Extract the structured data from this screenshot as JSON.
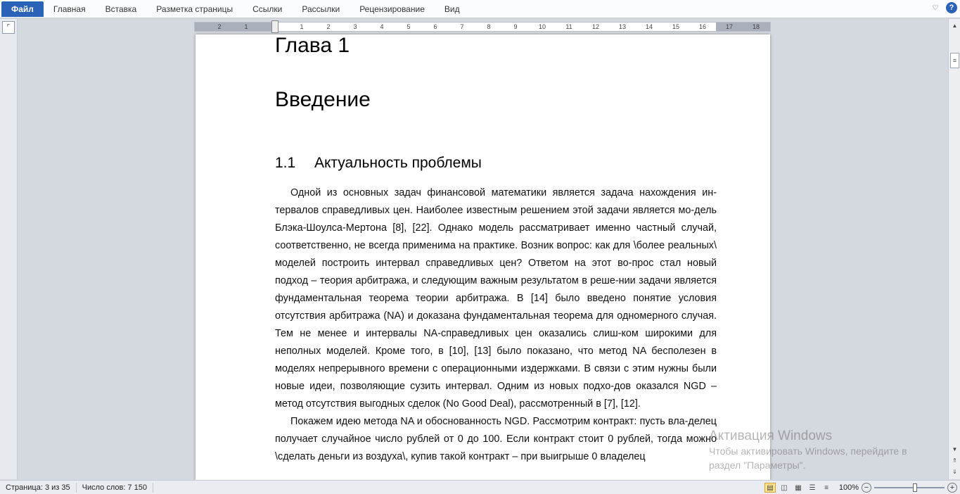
{
  "ribbon": {
    "file_label": "Файл",
    "tabs": [
      "Главная",
      "Вставка",
      "Разметка страницы",
      "Ссылки",
      "Рассылки",
      "Рецензирование",
      "Вид"
    ],
    "help_label": "?"
  },
  "ruler": {
    "ticks": [
      "2",
      "1",
      "1",
      "2",
      "3",
      "4",
      "5",
      "6",
      "7",
      "8",
      "9",
      "10",
      "11",
      "12",
      "13",
      "14",
      "15",
      "16",
      "17",
      "18"
    ]
  },
  "document": {
    "chapter": "Глава 1",
    "intro_heading": "Введение",
    "section_number": "1.1",
    "section_title": "Актуальность проблемы",
    "paragraph1": "Одной из основных задач финансовой математики является задача нахождения ин-тервалов справедливых цен. Наиболее известным решением этой задачи является мо-дель Блэка-Шоулса-Мертона [8], [22]. Однако модель рассматривает именно частный случай, соответственно, не всегда применима на практике. Возник вопрос: как для \\более реальных\\ моделей построить интервал справедливых цен? Ответом на этот во-прос стал новый подход – теория арбитража, и следующим важным результатом в реше-нии задачи является фундаментальная теорема теории арбитража. В [14] было введено понятие условия отсутствия арбитража (NA) и доказана фундаментальная теорема для одномерного случая. Тем не менее и интервалы NA-справедливых цен оказались слиш-ком широкими для неполных моделей. Кроме того, в [10], [13] было показано, что метод NA бесполезен в моделях непрерывного времени с операционными издержками. В связи с этим нужны были новые идеи, позволяющие сузить интервал. Одним из новых подхо-дов оказался NGD – метод отсутствия выгодных сделок (No Good Deal), рассмотренный в [7], [12].",
    "paragraph2": "Покажем идею метода NA и обоснованность NGD. Рассмотрим контракт: пусть вла-делец получает случайное число рублей от 0 до 100. Если контракт стоит 0 рублей, тогда можно \\сделать деньги из воздуха\\, купив такой контракт – при выигрыше 0 владелец"
  },
  "watermark": {
    "title": "Активация Windows",
    "text": "Чтобы активировать Windows, перейдите в раздел \"Параметры\"."
  },
  "status": {
    "page": "Страница: 3 из 35",
    "words": "Число слов: 7 150",
    "zoom": "100%"
  }
}
